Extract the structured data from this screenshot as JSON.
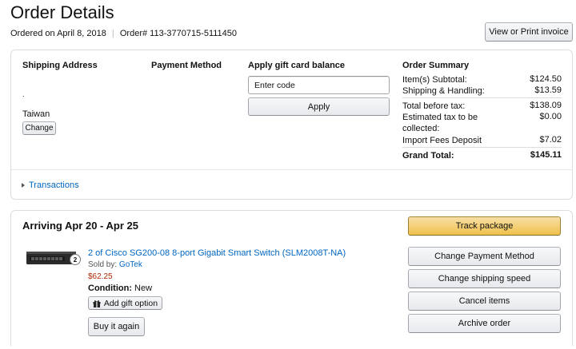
{
  "header": {
    "title": "Order Details",
    "ordered_on": "Ordered on April 8, 2018",
    "order_number": "Order# 113-3770715-5111450",
    "print_button": "View or Print invoice"
  },
  "shipping": {
    "heading": "Shipping Address",
    "line_dot": ".",
    "country": "Taiwan",
    "change_button": "Change"
  },
  "payment": {
    "heading": "Payment Method"
  },
  "gift_card": {
    "heading": "Apply gift card balance",
    "input_placeholder": "Enter code",
    "apply_button": "Apply"
  },
  "summary": {
    "heading": "Order Summary",
    "rows": [
      {
        "label": "Item(s) Subtotal:",
        "value": "$124.50"
      },
      {
        "label": "Shipping & Handling:",
        "value": "$13.59"
      },
      {
        "label": "Total before tax:",
        "value": "$138.09"
      },
      {
        "label": "Estimated tax to be collected:",
        "value": "$0.00"
      },
      {
        "label": "Import Fees Deposit",
        "value": "$7.02"
      },
      {
        "label": "Grand Total:",
        "value": "$145.11"
      }
    ]
  },
  "transactions": {
    "label": "Transactions"
  },
  "shipment": {
    "arriving": "Arriving Apr 20 - Apr 25",
    "item": {
      "quantity": "2",
      "title": "2 of Cisco SG200-08 8-port Gigabit Smart Switch (SLM2008T-NA)",
      "sold_by_label": "Sold by:",
      "seller": "GoTek",
      "price": "$62.25",
      "condition_label": "Condition:",
      "condition_value": "New",
      "gift_button": "Add gift option",
      "buy_again_button": "Buy it again"
    },
    "actions": {
      "track": "Track package",
      "change_payment": "Change Payment Method",
      "change_speed": "Change shipping speed",
      "cancel": "Cancel items",
      "archive": "Archive order"
    }
  },
  "colors": {
    "link": "#0066c0",
    "price": "#b12704",
    "track_button": "#f0c14b"
  }
}
